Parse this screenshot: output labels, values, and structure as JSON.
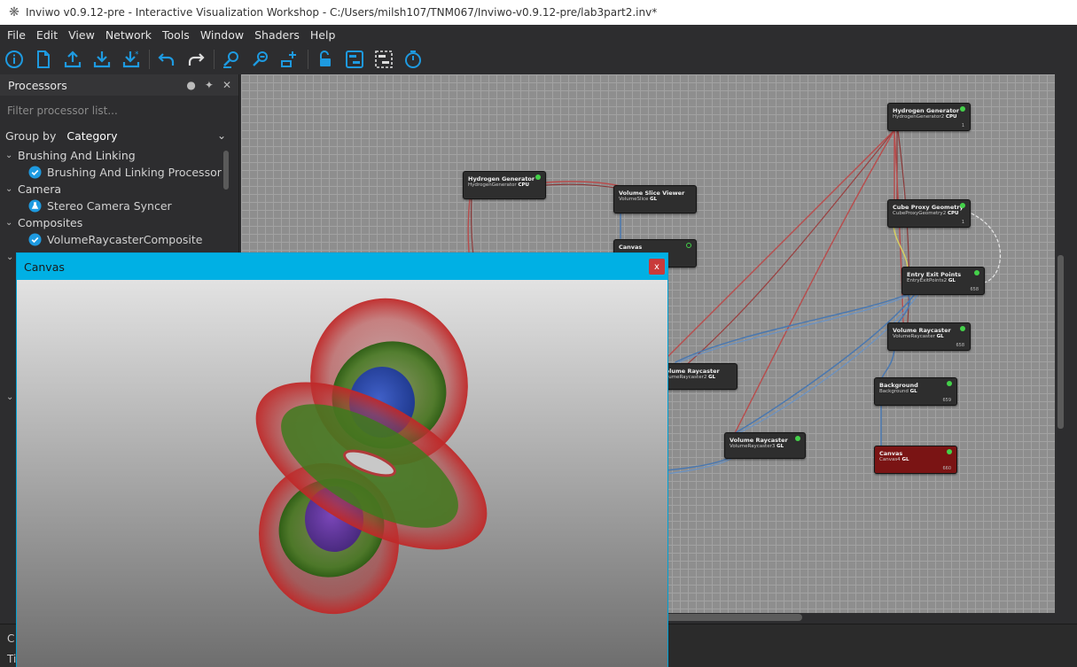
{
  "window": {
    "title": "Inviwo v0.9.12-pre - Interactive Visualization Workshop - C:/Users/milsh107/TNM067/Inviwo-v0.9.12-pre/lab3part2.inv*"
  },
  "menu": [
    "File",
    "Edit",
    "View",
    "Network",
    "Tools",
    "Window",
    "Shaders",
    "Help"
  ],
  "toolbar": {
    "icons": [
      "info-icon",
      "new-file-icon",
      "upload-icon",
      "download-icon",
      "download-star-icon",
      "undo-icon",
      "redo-icon",
      "zoom-fit-icon",
      "zoom-out-icon",
      "add-marker-icon",
      "lock-icon",
      "layout-icon",
      "selection-icon",
      "timer-icon"
    ],
    "accent": "#1e9ae0"
  },
  "processors_panel": {
    "title": "Processors",
    "filter_placeholder": "Filter processor list...",
    "group_by_label": "Group by",
    "group_by_value": "Category",
    "categories": [
      {
        "name": "Brushing And Linking",
        "items": [
          {
            "label": "Brushing And Linking Processor",
            "icon": "check-circle-icon"
          }
        ]
      },
      {
        "name": "Camera",
        "items": [
          {
            "label": "Stereo Camera Syncer",
            "icon": "flask-icon"
          }
        ]
      },
      {
        "name": "Composites",
        "items": [
          {
            "label": "VolumeRaycasterComposite",
            "icon": "check-circle-icon"
          }
        ]
      }
    ]
  },
  "network": {
    "processors": [
      {
        "id": "hg1",
        "name": "Hydrogen Generator",
        "identifier": "HydrogenGenerator",
        "platform": "CPU",
        "count": ""
      },
      {
        "id": "vsv",
        "name": "Volume Slice Viewer",
        "identifier": "VolumeSlice",
        "platform": "GL",
        "count": ""
      },
      {
        "id": "cnv1",
        "name": "Canvas",
        "identifier": "",
        "platform": "",
        "count": ""
      },
      {
        "id": "vr2",
        "name": "Volume Raycaster",
        "identifier": "VolumeRaycaster2",
        "platform": "GL",
        "count": ""
      },
      {
        "id": "vr3",
        "name": "Volume Raycaster",
        "identifier": "VolumeRaycaster3",
        "platform": "GL",
        "count": ""
      },
      {
        "id": "hg2",
        "name": "Hydrogen Generator",
        "identifier": "HydrogenGenerator2",
        "platform": "CPU",
        "count": "1"
      },
      {
        "id": "cpg",
        "name": "Cube Proxy Geometry",
        "identifier": "CubeProxyGeometry2",
        "platform": "CPU",
        "count": "1"
      },
      {
        "id": "eep",
        "name": "Entry Exit Points",
        "identifier": "EntryExitPoints2",
        "platform": "GL",
        "count": "658"
      },
      {
        "id": "vr1",
        "name": "Volume Raycaster",
        "identifier": "VolumeRaycaster",
        "platform": "GL",
        "count": "658"
      },
      {
        "id": "bg",
        "name": "Background",
        "identifier": "Background",
        "platform": "GL",
        "count": "659"
      },
      {
        "id": "cnv4",
        "name": "Canvas",
        "identifier": "Canvas4",
        "platform": "GL",
        "count": "660"
      }
    ],
    "colors": {
      "volume_port": "#b84c4c",
      "image_port": "#4a78b0",
      "mesh_port": "#c8c050",
      "canvas_red": "#7a1414",
      "status_green": "#44d14a"
    }
  },
  "bottom": {
    "tab_1": "C",
    "tab_2": "Tir"
  },
  "canvas_window": {
    "title": "Canvas",
    "close": "x"
  }
}
